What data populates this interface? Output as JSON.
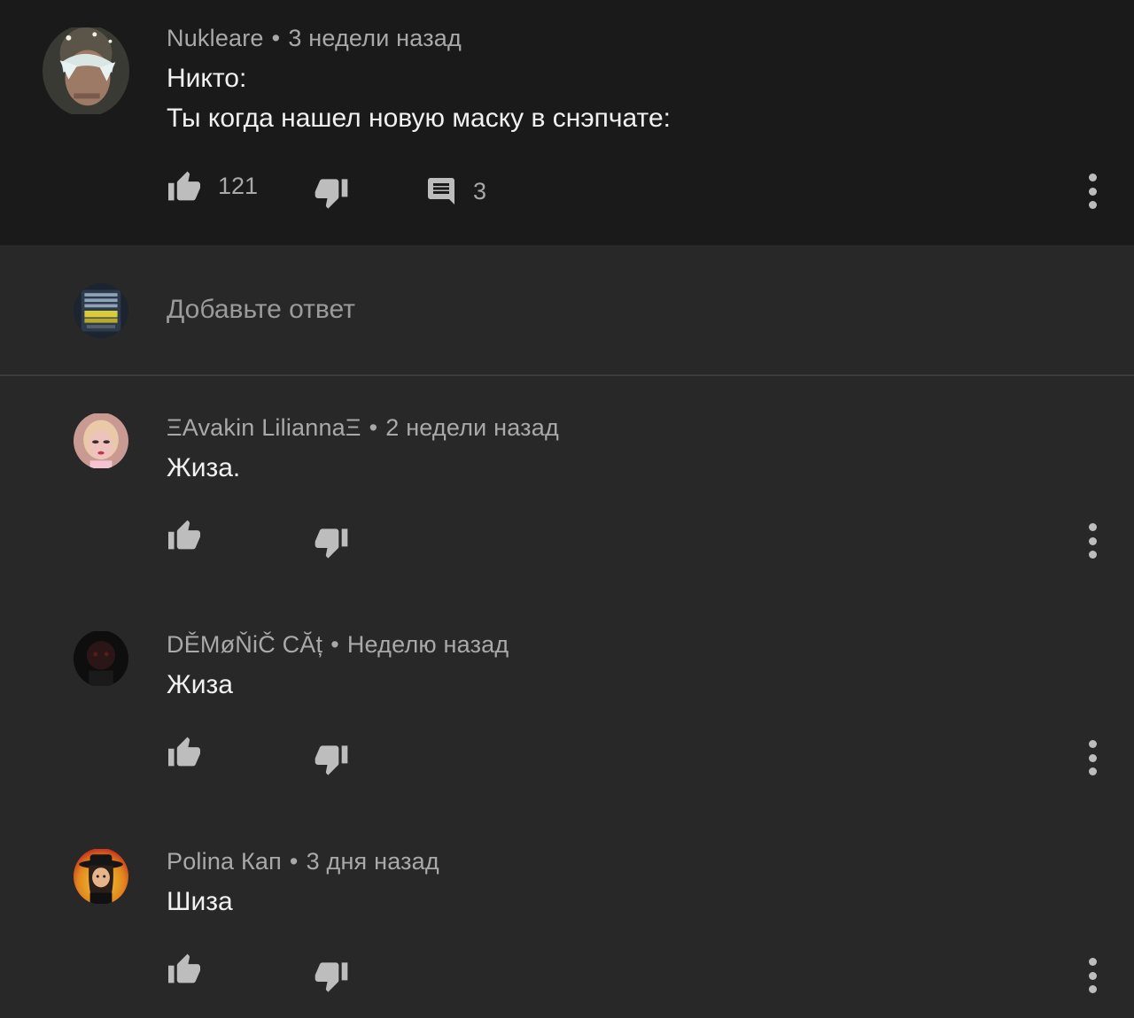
{
  "parent": {
    "author": "Nukleare",
    "time": "3 недели назад",
    "lines": [
      "Никто:",
      "Ты когда нашел новую маску в снэпчате:"
    ],
    "likes": "121",
    "replies": "3"
  },
  "reply_box": {
    "placeholder": "Добавьте ответ"
  },
  "replies": [
    {
      "author": "ΞAvakin LiliannaΞ",
      "time": "2 недели назад",
      "text": "Жиза."
    },
    {
      "author": "DĚMøŇiČ CĂț",
      "time": "Неделю назад",
      "text": "Жиза"
    },
    {
      "author": "Polina Кап",
      "time": "3 дня назад",
      "text": "Шиза"
    }
  ],
  "icons": {
    "like": "thumbs-up-icon",
    "dislike": "thumbs-down-icon",
    "reply": "comment-icon",
    "more": "more-vert-icon"
  },
  "colors": {
    "background": "#282828",
    "parent_background": "#1a1a1a",
    "text": "#f1f1f1",
    "meta": "#a9a9a9",
    "icon": "#bdbdbd"
  }
}
